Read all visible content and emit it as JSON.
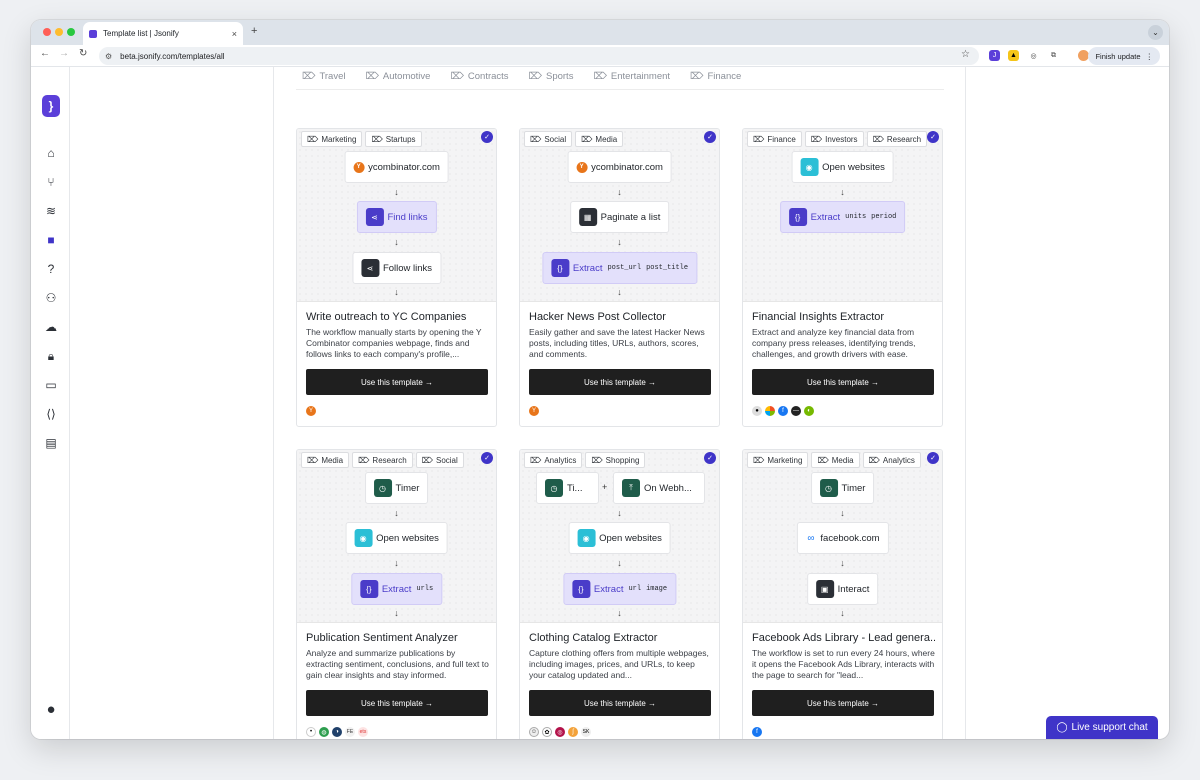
{
  "browser": {
    "tab_title": "Template list | Jsonify",
    "url": "beta.jsonify.com/templates/all",
    "finish_update": "Finish update",
    "new_tab": "+",
    "close_tab": "×",
    "colors": {
      "close": "#ff5f57",
      "min": "#febc2e",
      "max": "#28c840"
    }
  },
  "categories": [
    "Travel",
    "Automotive",
    "Contracts",
    "Sports",
    "Entertainment",
    "Finance"
  ],
  "cards": [
    {
      "tags": [
        "Marketing",
        "Startups"
      ],
      "title": "Write outreach to YC Companies",
      "desc": "The workflow manually starts by opening the Y Combinator companies webpage, finds and follows links to each company's profile,...",
      "nodes": {
        "n1": "ycombinator.com",
        "n2": "Find links",
        "n3": "Follow links"
      }
    },
    {
      "tags": [
        "Social",
        "Media"
      ],
      "title": "Hacker News Post Collector",
      "desc": "Easily gather and save the latest Hacker News posts, including titles, URLs, authors, scores, and comments.",
      "nodes": {
        "n1": "ycombinator.com",
        "n2": "Paginate a list",
        "n3": "Extract",
        "c1": "post_url",
        "c2": "post_title"
      }
    },
    {
      "tags": [
        "Finance",
        "Investors",
        "Research"
      ],
      "title": "Financial Insights Extractor",
      "desc": "Extract and analyze key financial data from company press releases, identifying trends, challenges, and growth drivers with ease.",
      "nodes": {
        "n1": "Open websites",
        "n2": "Extract",
        "c1": "units",
        "c2": "period"
      }
    },
    {
      "tags": [
        "Media",
        "Research",
        "Social"
      ],
      "title": "Publication Sentiment Analyzer",
      "desc": "Analyze and summarize publications by extracting sentiment, conclusions, and full text to gain clear insights and stay informed.",
      "nodes": {
        "n1": "Timer",
        "n2": "Open websites",
        "n3": "Extract",
        "c1": "urls"
      }
    },
    {
      "tags": [
        "Analytics",
        "Shopping"
      ],
      "title": "Clothing Catalog Extractor",
      "desc": "Capture clothing offers from multiple webpages, including images, prices, and URLs, to keep your catalog updated and...",
      "nodes": {
        "n1a": "Ti...",
        "plus": "+",
        "n1b": "On Webh...",
        "n2": "Open websites",
        "n3": "Extract",
        "c1": "url",
        "c2": "image"
      }
    },
    {
      "tags": [
        "Marketing",
        "Media",
        "Analytics"
      ],
      "title": "Facebook Ads Library - Lead genera...",
      "desc": "The workflow is set to run every 24 hours, where it opens the Facebook Ads Library, interacts with the page to search for \"lead...",
      "nodes": {
        "n1": "Timer",
        "n2": "facebook.com",
        "n3": "Interact"
      }
    }
  ],
  "use_template_label": "Use this template →",
  "yc_letter": "Y",
  "live_chat": "Live support chat",
  "icons": {
    "tag": "tag-icon",
    "check": "check-icon",
    "arrow": "↓",
    "brand": "#5b3fd9",
    "accent": "#3f34c8"
  },
  "logos": {
    "sk": "SK",
    "fe": "FE",
    "ets": "ets"
  }
}
